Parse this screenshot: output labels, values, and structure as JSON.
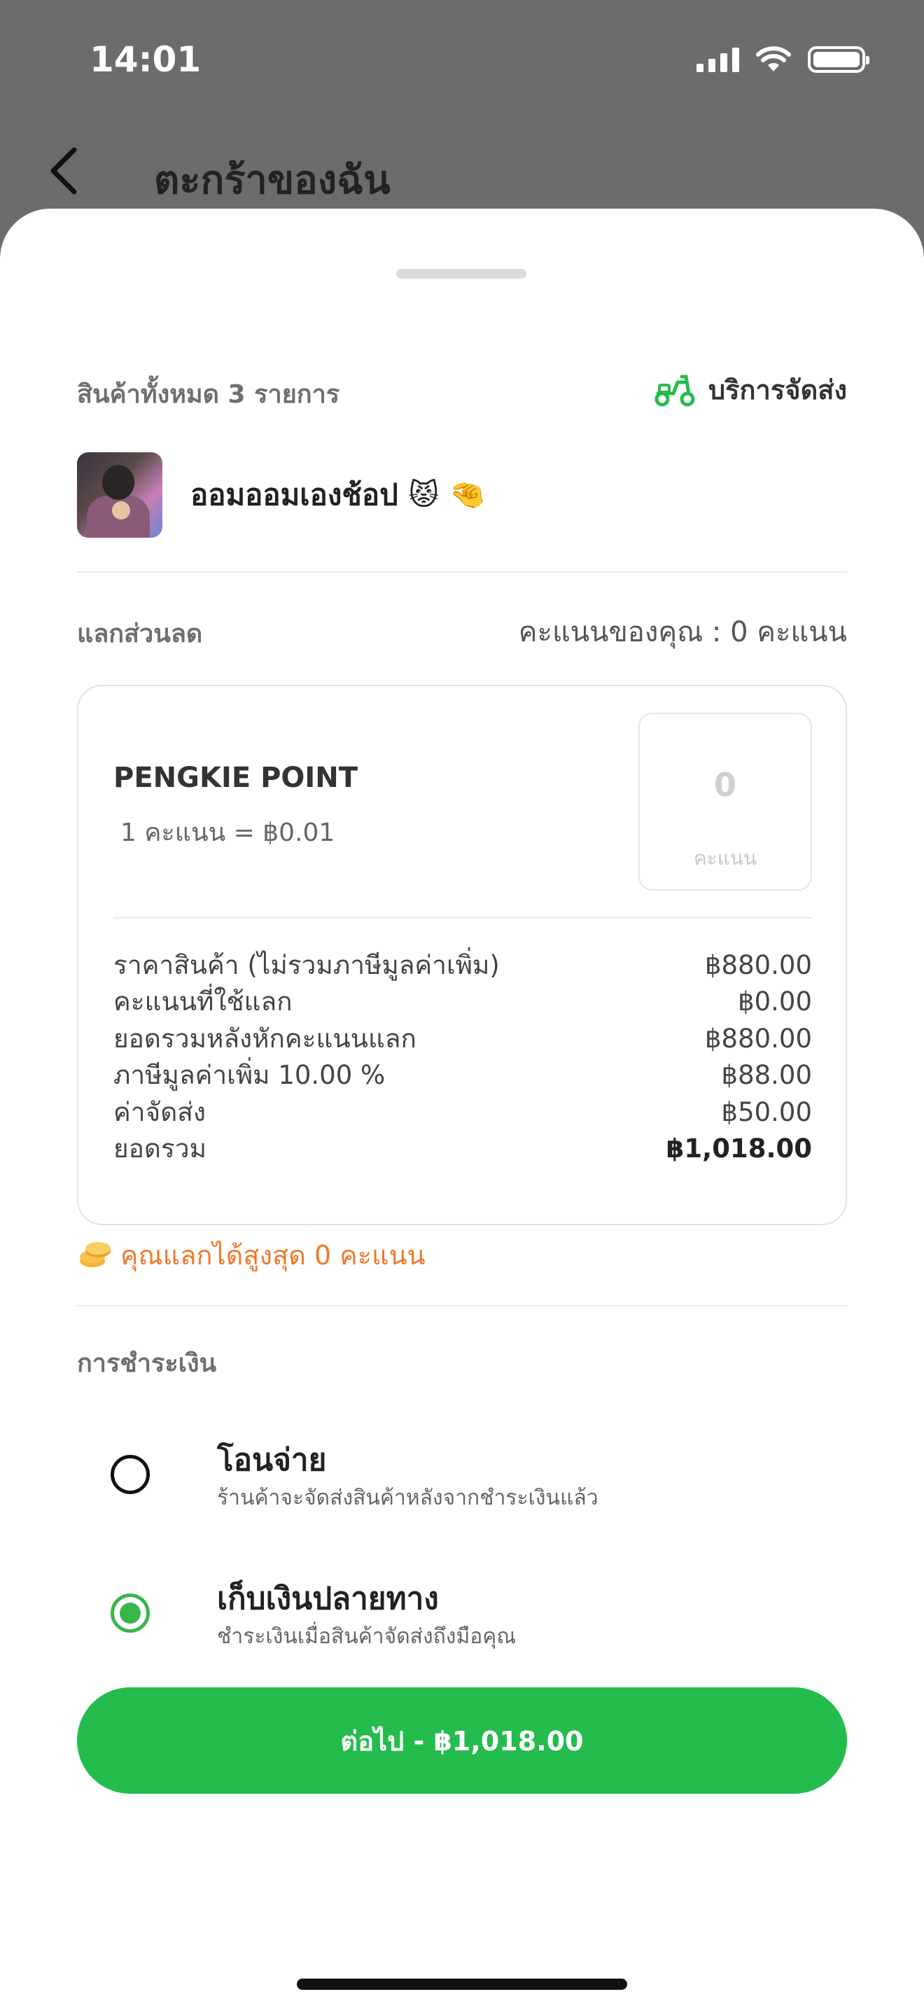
{
  "status_bar": {
    "time": "14:01"
  },
  "header": {
    "title": "ตะกร้าของฉัน"
  },
  "cart": {
    "item_count": "สินค้าทั้งหมด 3 รายการ",
    "delivery_label": "บริการจัดส่ง",
    "shop_name": "ออมออมเองช้อป 😾 🤏"
  },
  "redeem": {
    "title": "แลกส่วนลด",
    "my_points": "คะแนนของคุณ : 0 คะแนน",
    "points_name": "PENGKIE POINT",
    "points_rate": "1 คะแนน = ฿0.01",
    "input_value": "0",
    "input_unit": "คะแนน",
    "max_note": "คุณแลกได้สูงสุด 0 คะแนน"
  },
  "summary": {
    "rows": [
      {
        "label": "ราคาสินค้า (ไม่รวมภาษีมูลค่าเพิ่ม)",
        "value": "฿880.00"
      },
      {
        "label": "คะแนนที่ใช้แลก",
        "value": "฿0.00"
      },
      {
        "label": "ยอดรวมหลังหักคะแนนแลก",
        "value": "฿880.00"
      },
      {
        "label": "ภาษีมูลค่าเพิ่ม 10.00 %",
        "value": "฿88.00"
      },
      {
        "label": "ค่าจัดส่ง",
        "value": "฿50.00"
      },
      {
        "label": "ยอดรวม",
        "value": "฿1,018.00"
      }
    ]
  },
  "payment": {
    "title": "การชำระเงิน",
    "options": [
      {
        "label": "โอนจ่าย",
        "description": "ร้านค้าจะจัดส่งสินค้าหลังจากชำระเงินแล้ว",
        "selected": false
      },
      {
        "label": "เก็บเงินปลายทาง",
        "description": "ชำระเงินเมื่อสินค้าจัดส่งถึงมือคุณ",
        "selected": true
      }
    ]
  },
  "cta": {
    "label": "ต่อไป - ฿1,018.00"
  },
  "colors": {
    "accent": "#24bc4c",
    "warning": "#f07a2c",
    "overlay": "#6c6c6a"
  }
}
